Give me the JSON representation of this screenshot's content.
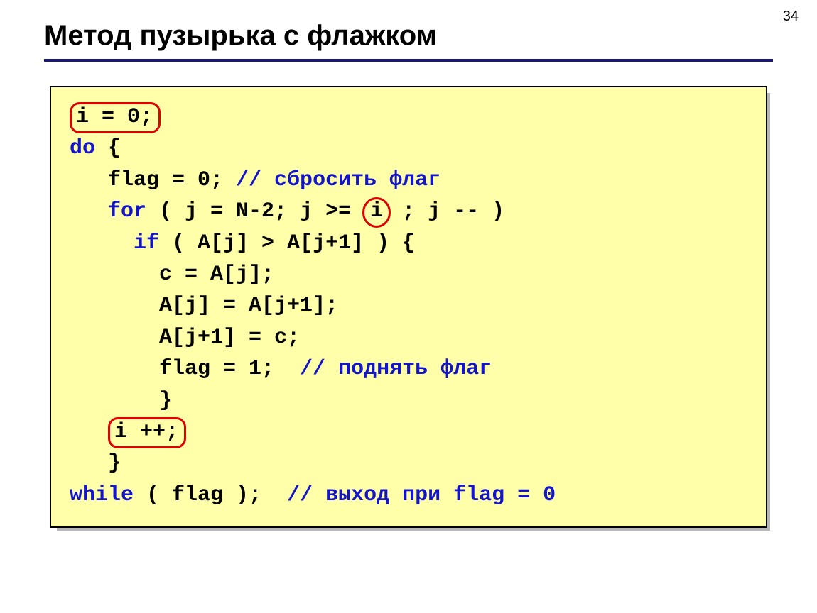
{
  "page_number": "34",
  "title": "Метод пузырька с флажком",
  "code": {
    "line1_boxed": "i = 0;",
    "line2_kw": "do",
    "line2_rest": " {",
    "line3_a": "   flag = 0; ",
    "line3_cmt": "// сбросить флаг",
    "line4_kw": "   for",
    "line4_a": " ( j = N-2; j >= ",
    "line4_circ": "i",
    "line4_b": " ; j -- )",
    "line5_kw": "     if",
    "line5_rest": " ( A[j] > A[j+1] ) {",
    "line6": "       с = A[j];",
    "line7": "       A[j] = A[j+1];",
    "line8": "       A[j+1] = с;",
    "line9_a": "       flag = 1;  ",
    "line9_cmt": "// поднять флаг",
    "line10": "       }",
    "line11_pad": "   ",
    "line11_boxed": "i ++;",
    "line12": "   }",
    "line13_kw": "while",
    "line13_a": " ( flag );  ",
    "line13_cmt": "// выход при flag = 0"
  }
}
